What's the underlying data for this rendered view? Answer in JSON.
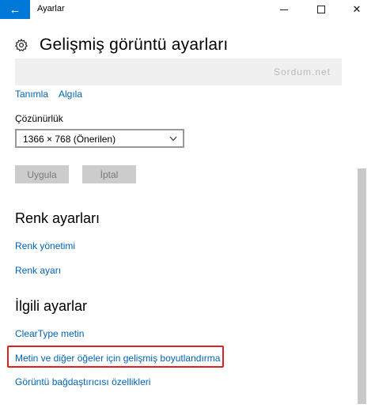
{
  "window": {
    "title": "Ayarlar",
    "back_glyph": "←",
    "close_glyph": "✕"
  },
  "header": {
    "title": "Gelişmiş görüntü ayarları"
  },
  "preview": {
    "watermark": "Sordum.net"
  },
  "display_links": {
    "identify": "Tanımla",
    "detect": "Algıla"
  },
  "resolution": {
    "label": "Çözünürlük",
    "selected": "1366 × 768 (Önerilen)"
  },
  "buttons": {
    "apply": "Uygula",
    "cancel": "İptal"
  },
  "color_settings": {
    "title": "Renk ayarları",
    "color_management": "Renk yönetimi",
    "color_calibration": "Renk ayarı"
  },
  "related_settings": {
    "title": "İlgili ayarlar",
    "cleartype": "ClearType metin",
    "advanced_sizing": "Metin ve diğer öğeler için gelişmiş boyutlandırma",
    "adapter_properties": "Görüntü bağdaştırıcısı özellikleri"
  },
  "colors": {
    "accent": "#0078d7",
    "link": "#0063b1",
    "highlight_border": "#e0201e"
  }
}
